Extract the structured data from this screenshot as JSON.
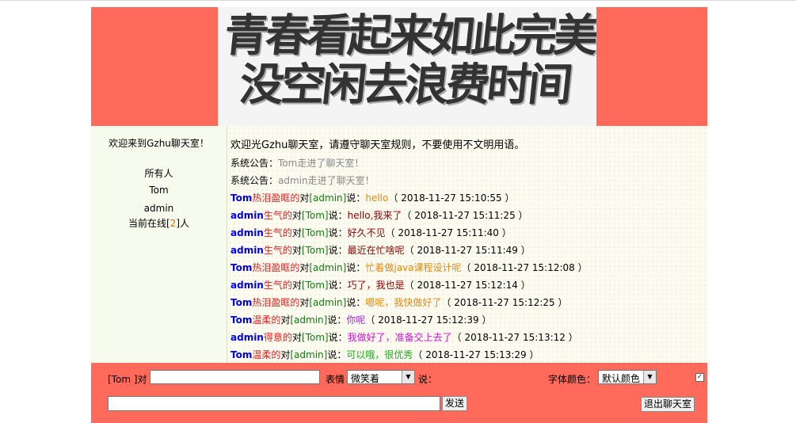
{
  "banner": {
    "line1": "青春看起来如此完美",
    "line2": "没空闲去浪费时间"
  },
  "sidebar": {
    "welcome": "欢迎来到Gzhu聊天室！",
    "users": [
      "所有人",
      "Tom",
      "admin"
    ],
    "online_prefix": "当前在线[",
    "online_count": "2",
    "online_suffix": "]人"
  },
  "chat": {
    "rule": "欢迎光Gzhu聊天室，请遵守聊天室规则，不要使用不文明用语。",
    "system": [
      {
        "label": "系统公告：",
        "text": "Tom走进了聊天室！"
      },
      {
        "label": "系统公告：",
        "text": "admin走进了聊天室！"
      }
    ],
    "messages": [
      {
        "from": "Tom",
        "emotion": "热泪盈眶的",
        "to": "admin",
        "text": "hello",
        "text_color": "#e38a14",
        "emotion_color": "#e02020",
        "time": "2018-11-27 15:10:55"
      },
      {
        "from": "admin",
        "emotion": "生气的",
        "to": "Tom",
        "text": "hello,我来了",
        "text_color": "#8b0000",
        "emotion_color": "#e02020",
        "time": "2018-11-27 15:11:25"
      },
      {
        "from": "admin",
        "emotion": "生气的",
        "to": "Tom",
        "text": "好久不见",
        "text_color": "#8b0000",
        "emotion_color": "#e02020",
        "time": "2018-11-27 15:11:40"
      },
      {
        "from": "admin",
        "emotion": "生气的",
        "to": "Tom",
        "text": "最近在忙啥呢",
        "text_color": "#8b0000",
        "emotion_color": "#e02020",
        "time": "2018-11-27 15:11:49"
      },
      {
        "from": "Tom",
        "emotion": "热泪盈眶的",
        "to": "admin",
        "text": "忙着做java课程设计呢",
        "text_color": "#e38a14",
        "emotion_color": "#e02020",
        "time": "2018-11-27 15:12:08"
      },
      {
        "from": "admin",
        "emotion": "生气的",
        "to": "Tom",
        "text": "巧了，我也是",
        "text_color": "#8b0000",
        "emotion_color": "#e02020",
        "time": "2018-11-27 15:12:14"
      },
      {
        "from": "Tom",
        "emotion": "热泪盈眶的",
        "to": "admin",
        "text": "嗯呢，我快做好了",
        "text_color": "#e38a14",
        "emotion_color": "#e02020",
        "time": "2018-11-27 15:12:25"
      },
      {
        "from": "Tom",
        "emotion": "温柔的",
        "to": "admin",
        "text": "你呢",
        "text_color": "#9932cc",
        "emotion_color": "#e02020",
        "time": "2018-11-27 15:12:39"
      },
      {
        "from": "admin",
        "emotion": "得意的",
        "to": "Tom",
        "text": "我做好了，准备交上去了",
        "text_color": "#d014d0",
        "emotion_color": "#e02020",
        "time": "2018-11-27 15:13:12"
      },
      {
        "from": "Tom",
        "emotion": "温柔的",
        "to": "admin",
        "text": "可以哦，很优秀",
        "text_color": "#22aa22",
        "emotion_color": "#e02020",
        "time": "2018-11-27 15:13:29"
      }
    ],
    "connector_to": "对",
    "connector_say": "说：",
    "ts_open": "（ ",
    "ts_close": " ）"
  },
  "bottom": {
    "target_label": "[Tom ]对",
    "target_value": "",
    "emotion_label": "表情",
    "emotion_selected": "微笑着",
    "say_label": "说：",
    "font_color_label": "字体颜色：",
    "font_color_selected": "默认颜色",
    "checkbox_mark": "✓",
    "message_value": "",
    "send_label": "发送",
    "exit_label": "退出聊天室",
    "dropdown_arrow": "▼"
  },
  "colors": {
    "accent": "#ff6a5a",
    "sidebar_bg": "#f6fbee",
    "chat_bg": "#fbfbef"
  }
}
